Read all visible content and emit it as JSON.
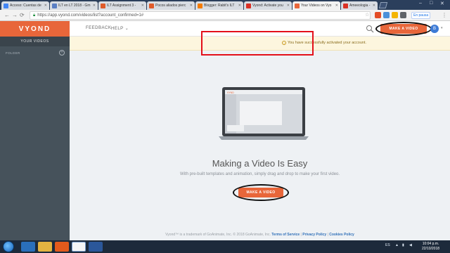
{
  "browser": {
    "tabs": [
      {
        "label": "Acceso: Cuentas de",
        "color": "#4285f4"
      },
      {
        "label": "ILT en LT 2018 - Gm",
        "color": "#5a7fc4"
      },
      {
        "label": "ILT Assignment 3 -",
        "color": "#e05b2a"
      },
      {
        "label": "Pocos aliados pierc",
        "color": "#e05b2a"
      },
      {
        "label": "Blogger: Rabit's ILT",
        "color": "#f57c00"
      },
      {
        "label": "Vyond: Activate you",
        "color": "#d93025"
      },
      {
        "label": "Your Videos on Vyo",
        "color": "#e8663a"
      },
      {
        "label": "Ameeologia - Did y",
        "color": "#d93025"
      }
    ],
    "url": "https://app.vyond.com/videos/list?account_confirmed=1#",
    "profile_chip": "En pausa"
  },
  "header": {
    "logo": "VYOND",
    "feedback": "FEEDBACK",
    "help": "HELP",
    "make_video": "MAKE A VIDEO",
    "avatar_letter": "B"
  },
  "sidebar": {
    "your_videos": "YOUR VIDEOS",
    "folder": "FOLDER"
  },
  "notice": {
    "text": "You have successfully activated your account."
  },
  "main": {
    "laptop_brand": "VYND",
    "title": "Making a Video Is Easy",
    "subtitle": "With pre-built templates and animation, simply drag and drop to make your first video.",
    "make_video": "MAKE A VIDEO"
  },
  "footer": {
    "prefix": "Vyond™ is a trademark of GoAnimate, Inc. © 2018 GoAnimate, Inc.",
    "terms": "Terms of Service",
    "privacy": "Privacy Policy",
    "cookies": "Cookies Policy"
  },
  "taskbar": {
    "lang": "ES",
    "time": "10:04 p.m.",
    "date": "22/10/2018"
  }
}
